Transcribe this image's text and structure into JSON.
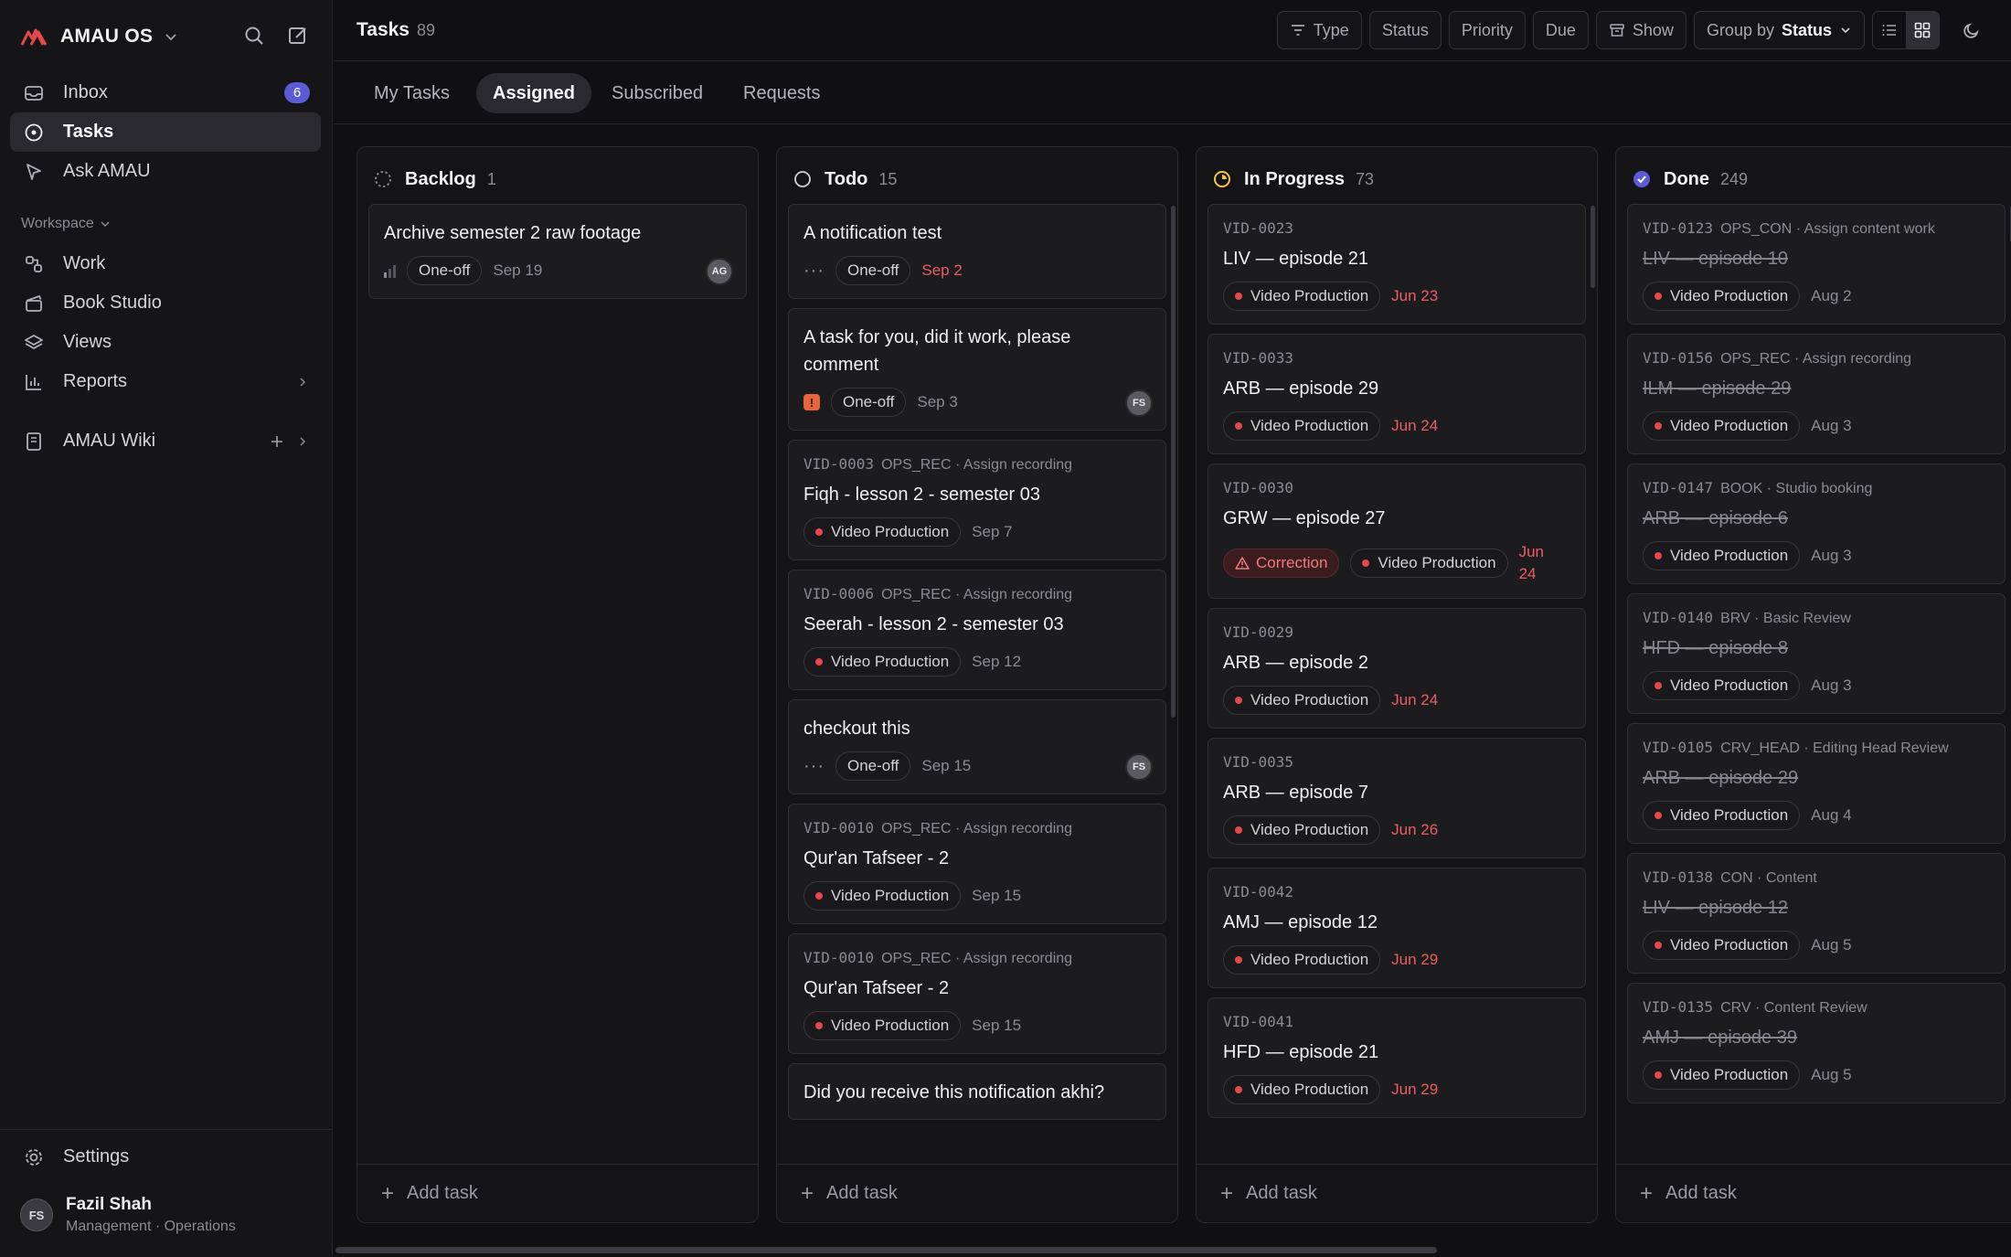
{
  "app": {
    "name": "AMAU OS"
  },
  "sidebar": {
    "items": [
      {
        "label": "Inbox",
        "badge": "6"
      },
      {
        "label": "Tasks"
      },
      {
        "label": "Ask AMAU"
      }
    ],
    "workspace_label": "Workspace",
    "workspace_items": [
      {
        "label": "Work"
      },
      {
        "label": "Book Studio"
      },
      {
        "label": "Views"
      },
      {
        "label": "Reports"
      }
    ],
    "wiki_label": "AMAU Wiki",
    "settings_label": "Settings",
    "user": {
      "initials": "FS",
      "name": "Fazil Shah",
      "role": "Management · Operations"
    }
  },
  "header": {
    "title": "Tasks",
    "count": "89",
    "filters": {
      "type": "Type",
      "status": "Status",
      "priority": "Priority",
      "due": "Due",
      "show": "Show",
      "group_by_label": "Group by",
      "group_by_value": "Status"
    }
  },
  "tabs": [
    "My Tasks",
    "Assigned",
    "Subscribed",
    "Requests"
  ],
  "add_task_label": "Add task",
  "columns": [
    {
      "title": "Backlog",
      "count": "1",
      "cards": [
        {
          "title": "Archive semester 2 raw footage",
          "chip": "One-off",
          "date": "Sep 19",
          "avatar": "AG"
        }
      ]
    },
    {
      "title": "Todo",
      "count": "15",
      "cards": [
        {
          "title": "A notification test",
          "chip": "One-off",
          "date": "Sep 2",
          "date_red": true
        },
        {
          "title": "A task for you, did it work, please comment",
          "chip": "One-off",
          "date": "Sep 3",
          "avatar": "FS"
        },
        {
          "code": "VID-0003",
          "meta": "OPS_REC · Assign recording",
          "title": "Fiqh - lesson 2 - semester 03",
          "chip": "Video Production",
          "date": "Sep 7"
        },
        {
          "code": "VID-0006",
          "meta": "OPS_REC · Assign recording",
          "title": "Seerah - lesson 2 - semester 03",
          "chip": "Video Production",
          "date": "Sep 12"
        },
        {
          "title": "checkout this",
          "chip": "One-off",
          "date": "Sep 15",
          "avatar": "FS"
        },
        {
          "code": "VID-0010",
          "meta": "OPS_REC · Assign recording",
          "title": "Qur'an Tafseer - 2",
          "chip": "Video Production",
          "date": "Sep 15"
        },
        {
          "code": "VID-0010",
          "meta": "OPS_REC · Assign recording",
          "title": "Qur'an Tafseer - 2",
          "chip": "Video Production",
          "date": "Sep 15"
        },
        {
          "title": "Did you receive this notification akhi?"
        }
      ]
    },
    {
      "title": "In Progress",
      "count": "73",
      "cards": [
        {
          "code": "VID-0023",
          "title": "LIV — episode 21",
          "chip": "Video Production",
          "date": "Jun 23"
        },
        {
          "code": "VID-0033",
          "title": "ARB — episode 29",
          "chip": "Video Production",
          "date": "Jun 24"
        },
        {
          "code": "VID-0030",
          "title": "GRW — episode 27",
          "correction": "Correction",
          "chip": "Video Production",
          "date": "Jun 24"
        },
        {
          "code": "VID-0029",
          "title": "ARB — episode 2",
          "chip": "Video Production",
          "date": "Jun 24"
        },
        {
          "code": "VID-0035",
          "title": "ARB — episode 7",
          "chip": "Video Production",
          "date": "Jun 26"
        },
        {
          "code": "VID-0042",
          "title": "AMJ — episode 12",
          "chip": "Video Production",
          "date": "Jun 29"
        },
        {
          "code": "VID-0041",
          "title": "HFD — episode 21",
          "chip": "Video Production",
          "date": "Jun 29"
        }
      ]
    },
    {
      "title": "Done",
      "count": "249",
      "cards": [
        {
          "code": "VID-0123",
          "meta": "OPS_CON · Assign content work",
          "title": "LIV — episode 10",
          "chip": "Video Production",
          "date": "Aug 2"
        },
        {
          "code": "VID-0156",
          "meta": "OPS_REC · Assign recording",
          "title": "ILM — episode 29",
          "chip": "Video Production",
          "date": "Aug 3"
        },
        {
          "code": "VID-0147",
          "meta": "BOOK · Studio booking",
          "title": "ARB — episode 6",
          "chip": "Video Production",
          "date": "Aug 3"
        },
        {
          "code": "VID-0140",
          "meta": "BRV · Basic Review",
          "title": "HFD — episode 8",
          "chip": "Video Production",
          "date": "Aug 3"
        },
        {
          "code": "VID-0105",
          "meta": "CRV_HEAD · Editing Head Review",
          "title": "ARB — episode 29",
          "chip": "Video Production",
          "date": "Aug 4"
        },
        {
          "code": "VID-0138",
          "meta": "CON · Content",
          "title": "LIV — episode 12",
          "chip": "Video Production",
          "date": "Aug 5"
        },
        {
          "code": "VID-0135",
          "meta": "CRV · Content Review",
          "title": "AMJ — episode 39",
          "chip": "Video Production",
          "date": "Aug 5"
        }
      ]
    }
  ],
  "colors": {
    "accent": "#5b5bd6",
    "danger": "#e5484d",
    "in_progress": "#f5c542",
    "brand": "#e5484d"
  }
}
